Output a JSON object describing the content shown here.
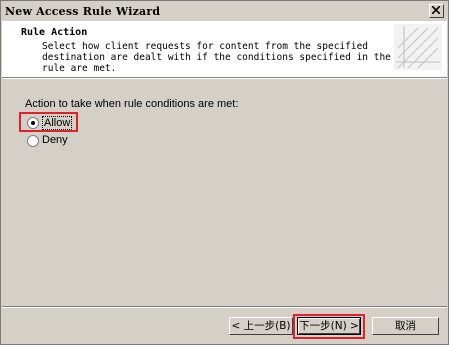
{
  "window": {
    "title": "New Access Rule Wizard"
  },
  "header": {
    "title": "Rule Action",
    "description": "Select how client requests for content from the specified destination are dealt with if the conditions specified in the rule are met."
  },
  "action": {
    "prompt": "Action to take when rule conditions are met:",
    "options": [
      {
        "label": "Allow",
        "selected": true
      },
      {
        "label": "Deny",
        "selected": false
      }
    ]
  },
  "buttons": {
    "back": "< 上一步(B)",
    "next": "下一步(N) >",
    "cancel": "取消"
  },
  "colors": {
    "highlight": "#e0212b",
    "dialog_bg": "#d4d0c8"
  }
}
